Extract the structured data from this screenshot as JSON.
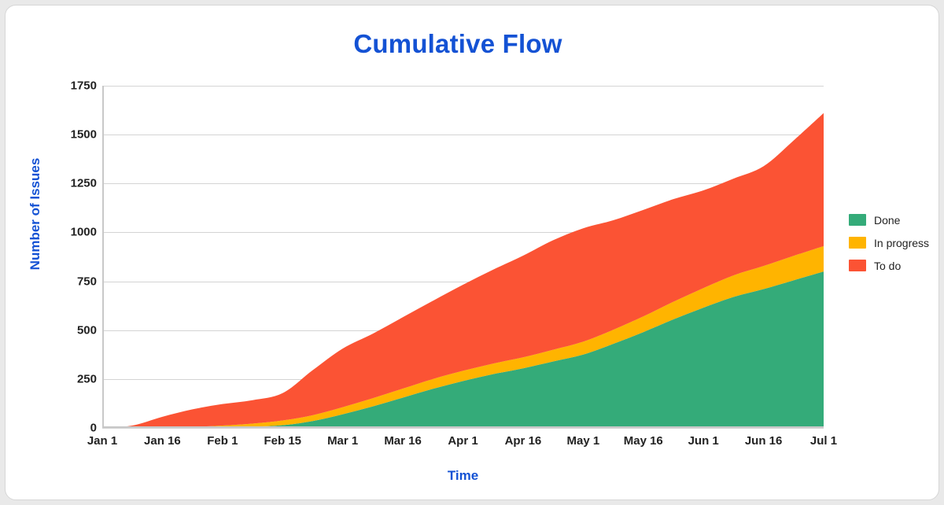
{
  "chart_data": {
    "type": "area",
    "stacked": true,
    "title": "Cumulative Flow",
    "xlabel": "Time",
    "ylabel": "Number of Issues",
    "grid": true,
    "legend_position": "right",
    "ylim": [
      0,
      1750
    ],
    "yticks": [
      0,
      250,
      500,
      750,
      1000,
      1250,
      1500,
      1750
    ],
    "ytick_labels": [
      "0",
      "250",
      "500",
      "750",
      "1000",
      "1250",
      "1500",
      "1750"
    ],
    "categories": [
      "Jan 1",
      "Jan 16",
      "Feb 1",
      "Feb 15",
      "Mar 1",
      "Mar 16",
      "Apr 1",
      "Apr 16",
      "May 1",
      "May 16",
      "Jun 1",
      "Jun 16",
      "Jul 1"
    ],
    "x": [
      "Jan 1",
      "Jan 8",
      "Jan 16",
      "Jan 24",
      "Feb 1",
      "Feb 8",
      "Feb 15",
      "Feb 22",
      "Mar 1",
      "Mar 8",
      "Mar 16",
      "Mar 24",
      "Apr 1",
      "Apr 8",
      "Apr 16",
      "Apr 24",
      "May 1",
      "May 8",
      "May 16",
      "May 24",
      "Jun 1",
      "Jun 8",
      "Jun 16",
      "Jun 24",
      "Jul 1"
    ],
    "series": [
      {
        "name": "Done",
        "color": "#34ab79",
        "values": [
          0,
          0,
          0,
          0,
          2,
          6,
          14,
          35,
          70,
          110,
          155,
          200,
          240,
          275,
          305,
          340,
          375,
          430,
          490,
          555,
          615,
          670,
          710,
          755,
          800
        ]
      },
      {
        "name": "In progress",
        "color": "#ffb400",
        "values": [
          0,
          0,
          2,
          5,
          10,
          16,
          24,
          30,
          36,
          42,
          46,
          50,
          52,
          54,
          56,
          60,
          66,
          72,
          80,
          90,
          100,
          110,
          118,
          125,
          130
        ]
      },
      {
        "name": "To do",
        "color": "#fb5334",
        "values": [
          0,
          12,
          55,
          90,
          110,
          120,
          140,
          230,
          300,
          330,
          365,
          400,
          440,
          480,
          520,
          560,
          580,
          560,
          545,
          525,
          500,
          495,
          510,
          590,
          680
        ]
      }
    ],
    "stack_totals": [
      0,
      12,
      57,
      95,
      122,
      142,
      178,
      295,
      406,
      482,
      566,
      650,
      732,
      809,
      881,
      960,
      1021,
      1062,
      1115,
      1170,
      1215,
      1275,
      1338,
      1470,
      1610
    ],
    "end_values": {
      "done_top": 800,
      "in_progress_top": 930,
      "to_do_top": 1610
    }
  },
  "legend": {
    "items": [
      {
        "label": "Done",
        "color": "#34ab79"
      },
      {
        "label": "In progress",
        "color": "#ffb400"
      },
      {
        "label": "To do",
        "color": "#fb5334"
      }
    ]
  },
  "colors": {
    "accent_blue": "#1452d4",
    "tick_text": "#222222",
    "gridline": "#d4d4d4",
    "axis_line": "#c8c8c8",
    "card_background": "#ffffff",
    "card_border": "#d6d6d6"
  }
}
